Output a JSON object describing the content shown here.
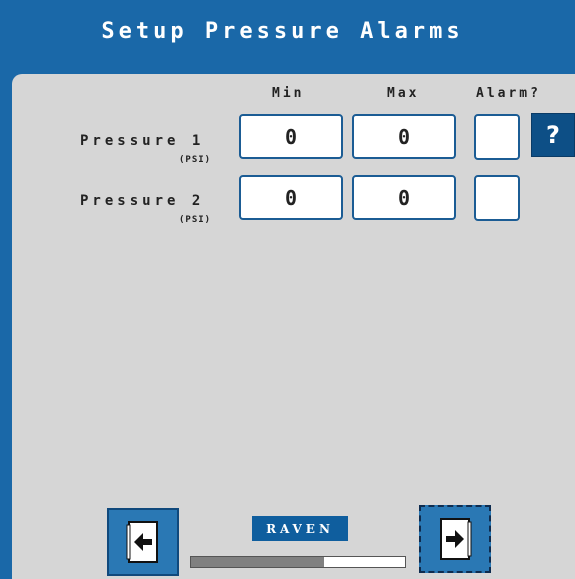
{
  "title": "Setup Pressure Alarms",
  "columns": {
    "min": "Min",
    "max": "Max",
    "alarm": "Alarm?"
  },
  "rows": [
    {
      "label": "Pressure 1",
      "unit": "(PSI)",
      "min": "0",
      "max": "0",
      "alarm_checked": false
    },
    {
      "label": "Pressure 2",
      "unit": "(PSI)",
      "min": "0",
      "max": "0",
      "alarm_checked": false
    }
  ],
  "help": {
    "label": "?"
  },
  "footer": {
    "brand": "RAVEN",
    "progress_fraction": 0.62,
    "back_icon": "back-page-icon",
    "next_icon": "next-page-icon"
  },
  "colors": {
    "frame": "#1a68a8",
    "panel": "#d6d6d6",
    "field_border": "#1b5c94",
    "help_button": "#0d4f86"
  }
}
